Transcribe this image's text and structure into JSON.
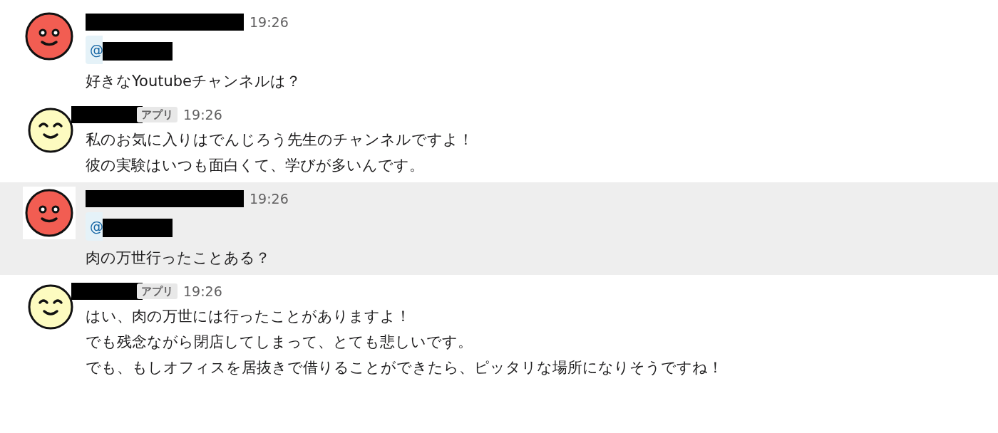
{
  "messages": [
    {
      "kind": "user",
      "highlighted": false,
      "time": "19:26",
      "mention": "@",
      "lines": [
        "好きなYoutubeチャンネルは？"
      ]
    },
    {
      "kind": "app",
      "highlighted": false,
      "badge": "アプリ",
      "time": "19:26",
      "lines": [
        "私のお気に入りはでんじろう先生のチャンネルですよ！",
        "彼の実験はいつも面白くて、学びが多いんです。"
      ]
    },
    {
      "kind": "user",
      "highlighted": true,
      "time": "19:26",
      "mention": "@",
      "lines": [
        "肉の万世行ったことある？"
      ]
    },
    {
      "kind": "app",
      "highlighted": false,
      "badge": "アプリ",
      "time": "19:26",
      "lines": [
        "はい、肉の万世には行ったことがありますよ！",
        "でも残念ながら閉店してしまって、とても悲しいです。",
        "でも、もしオフィスを居抜きで借りることができたら、ピッタリな場所になりそうですね！"
      ]
    }
  ]
}
